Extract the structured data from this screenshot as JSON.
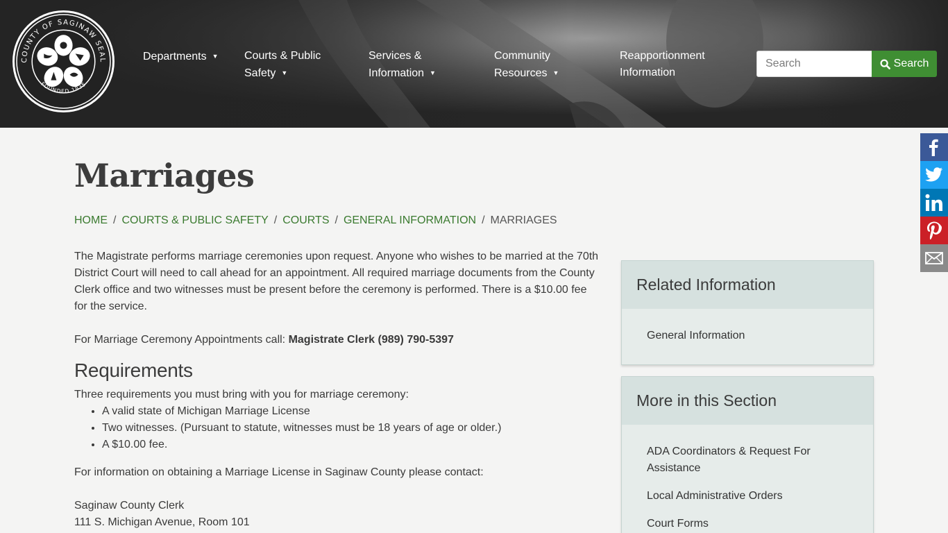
{
  "header": {
    "seal": {
      "top_text": "COUNTY OF SAGINAW SEAL",
      "bottom_text": "FOUNDED 1835"
    },
    "nav": [
      {
        "line1": "Departments",
        "line2": "",
        "has_caret": true
      },
      {
        "line1": "Courts & Public",
        "line2": "Safety",
        "has_caret": true
      },
      {
        "line1": "Services &",
        "line2": "Information",
        "has_caret": true
      },
      {
        "line1": "Community",
        "line2": "Resources",
        "has_caret": true
      },
      {
        "line1": "Reapportionment",
        "line2": "Information",
        "has_caret": false
      }
    ],
    "search": {
      "placeholder": "Search",
      "button_label": "Search"
    }
  },
  "social": [
    {
      "name": "facebook",
      "color": "#3b5998",
      "glyph": "f"
    },
    {
      "name": "twitter",
      "color": "#1da1f2",
      "glyph": ""
    },
    {
      "name": "linkedin",
      "color": "#0077b5",
      "glyph": "in"
    },
    {
      "name": "pinterest",
      "color": "#cb2027",
      "glyph": "P"
    },
    {
      "name": "email",
      "color": "#8a8a8a",
      "glyph": ""
    }
  ],
  "page": {
    "title": "Marriages",
    "breadcrumb": [
      "HOME",
      "COURTS & PUBLIC SAFETY",
      "COURTS",
      "GENERAL INFORMATION",
      "MARRIAGES"
    ]
  },
  "content": {
    "intro": "The Magistrate performs marriage ceremonies upon request. Anyone who wishes to be married at the 70th District Court will need to call ahead for an appointment. All required marriage documents from the County Clerk office and two witnesses must be present before the ceremony is performed. There is a $10.00 fee for the service.",
    "appointment_label": "For Marriage Ceremony Appointments call:",
    "appointment_contact": "Magistrate Clerk (989) 790-5397",
    "requirements_heading": "Requirements",
    "requirements_intro": "Three requirements you must bring with you for marriage ceremony:",
    "requirements": [
      "A valid state of Michigan Marriage License",
      "Two witnesses. (Pursuant to statute, witnesses must be 18 years of age or older.)",
      "A $10.00 fee."
    ],
    "license_info": "For information on obtaining a Marriage License in Saginaw County please contact:",
    "address_line1": "Saginaw County Clerk",
    "address_line2": "111 S. Michigan Avenue, Room 101"
  },
  "sidebar": {
    "related": {
      "title": "Related Information",
      "links": [
        "General Information"
      ]
    },
    "more": {
      "title": "More in this Section",
      "links": [
        "ADA Coordinators & Request For Assistance",
        "Local Administrative Orders",
        "Court Forms"
      ]
    }
  },
  "colors": {
    "accent_green": "#3f8e33",
    "link_green": "#3a7a2f",
    "header_dark": "#222222"
  }
}
